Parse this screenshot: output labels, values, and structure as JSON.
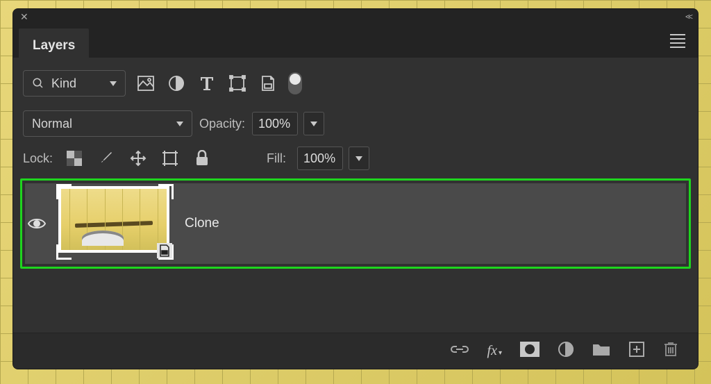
{
  "panel": {
    "title": "Layers"
  },
  "filter": {
    "kind_label": "Kind"
  },
  "blend": {
    "mode": "Normal",
    "opacity_label": "Opacity:",
    "opacity_value": "100%"
  },
  "lock": {
    "label": "Lock:",
    "fill_label": "Fill:",
    "fill_value": "100%"
  },
  "layers": [
    {
      "name": "Clone",
      "visible": true,
      "smart": true
    }
  ],
  "bottom": {
    "fx_label": "fx"
  }
}
